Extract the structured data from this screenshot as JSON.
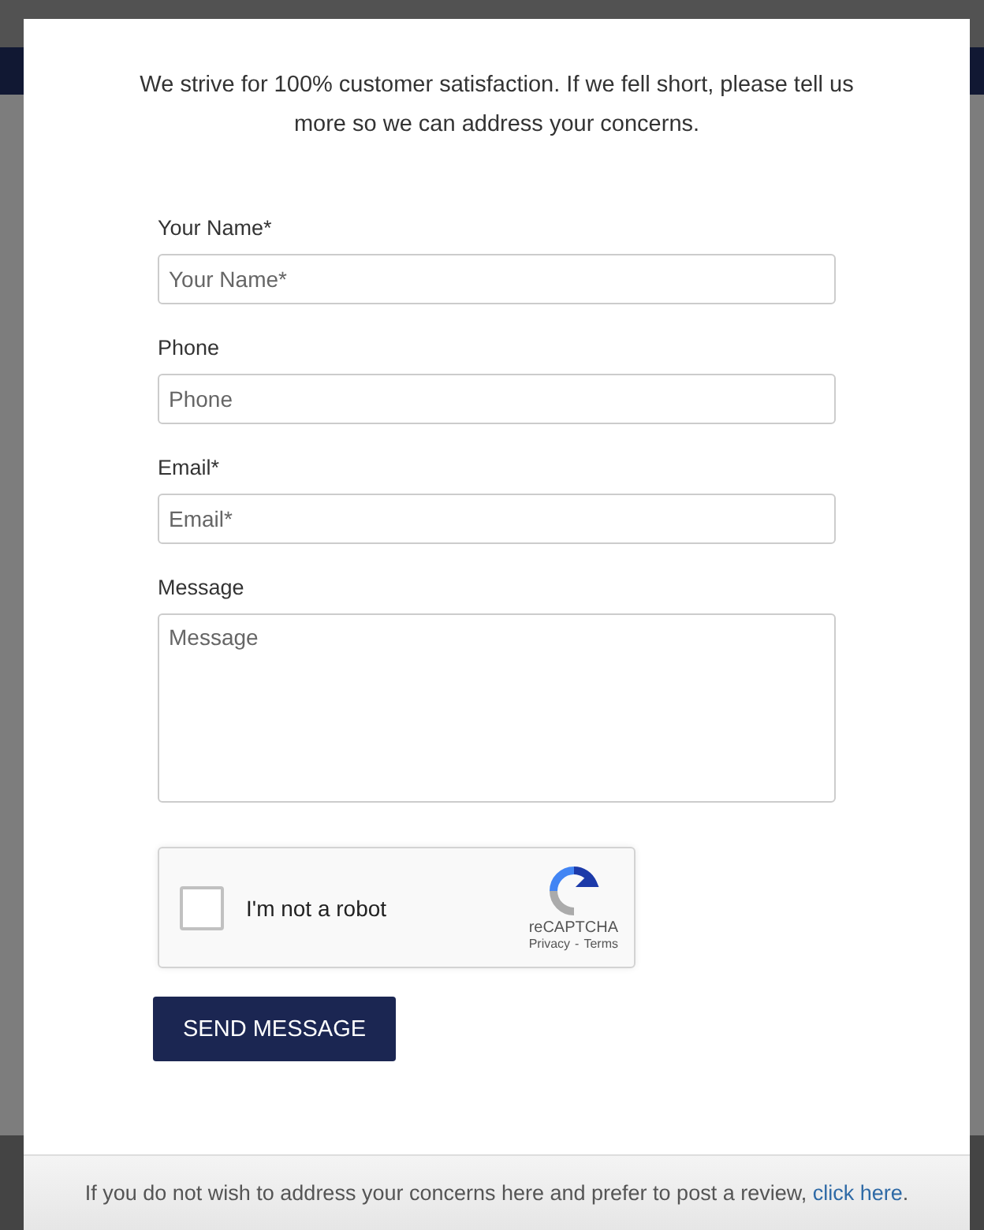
{
  "intro": "We strive for 100% customer satisfaction. If we fell short, please tell us more so we can address your concerns.",
  "fields": [
    {
      "label": "Your Name*",
      "placeholder": "Your Name*",
      "kind": "text"
    },
    {
      "label": "Phone",
      "placeholder": "Phone",
      "kind": "text"
    },
    {
      "label": "Email*",
      "placeholder": "Email*",
      "kind": "text"
    },
    {
      "label": "Message",
      "placeholder": "Message",
      "kind": "textarea"
    }
  ],
  "captcha": {
    "label": "I'm not a robot",
    "checked": false,
    "brand": "reCAPTCHA",
    "privacy": "Privacy",
    "separator": "-",
    "terms": "Terms"
  },
  "submit_button": "SEND MESSAGE",
  "footer": {
    "before": "If you do not wish to address your concerns here and prefer to post a review, ",
    "link": "click here",
    "after": "."
  }
}
